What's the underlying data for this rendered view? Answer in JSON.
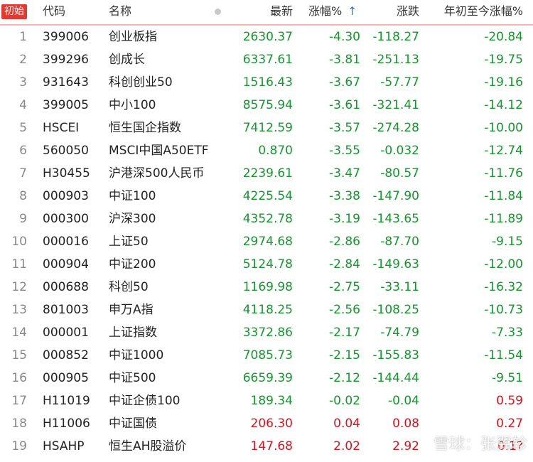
{
  "header": {
    "tag": "初始",
    "code": "代码",
    "name": "名称",
    "last": "最新",
    "pct": "涨幅%",
    "chg": "涨跌",
    "ytd": "年初至今涨幅%",
    "sort_arrow": "↑"
  },
  "rows": [
    {
      "idx": "1",
      "code": "399006",
      "name": "创业板指",
      "last": "2630.37",
      "pct": "-4.30",
      "chg": "-118.27",
      "ytd": "-20.84"
    },
    {
      "idx": "2",
      "code": "399296",
      "name": "创成长",
      "last": "6337.61",
      "pct": "-3.81",
      "chg": "-251.13",
      "ytd": "-19.75"
    },
    {
      "idx": "3",
      "code": "931643",
      "name": "科创创业50",
      "last": "1516.43",
      "pct": "-3.67",
      "chg": "-57.77",
      "ytd": "-19.16"
    },
    {
      "idx": "4",
      "code": "399005",
      "name": "中小100",
      "last": "8575.94",
      "pct": "-3.61",
      "chg": "-321.41",
      "ytd": "-14.12"
    },
    {
      "idx": "5",
      "code": "HSCEI",
      "name": "恒生国企指数",
      "last": "7412.59",
      "pct": "-3.57",
      "chg": "-274.28",
      "ytd": "-10.00"
    },
    {
      "idx": "6",
      "code": "560050",
      "name": "MSCI中国A50ETF",
      "last": "0.870",
      "pct": "-3.55",
      "chg": "-0.032",
      "ytd": "-12.74"
    },
    {
      "idx": "7",
      "code": "H30455",
      "name": "沪港深500人民币",
      "last": "2239.61",
      "pct": "-3.47",
      "chg": "-80.57",
      "ytd": "-11.76"
    },
    {
      "idx": "8",
      "code": "000903",
      "name": "中证100",
      "last": "4225.54",
      "pct": "-3.38",
      "chg": "-147.90",
      "ytd": "-11.84"
    },
    {
      "idx": "9",
      "code": "000300",
      "name": "沪深300",
      "last": "4352.78",
      "pct": "-3.19",
      "chg": "-143.65",
      "ytd": "-11.89"
    },
    {
      "idx": "10",
      "code": "000016",
      "name": "上证50",
      "last": "2974.68",
      "pct": "-2.86",
      "chg": "-87.70",
      "ytd": "-9.15"
    },
    {
      "idx": "11",
      "code": "000904",
      "name": "中证200",
      "last": "5124.78",
      "pct": "-2.84",
      "chg": "-149.63",
      "ytd": "-12.00"
    },
    {
      "idx": "12",
      "code": "000688",
      "name": "科创50",
      "last": "1169.98",
      "pct": "-2.75",
      "chg": "-33.11",
      "ytd": "-16.32"
    },
    {
      "idx": "13",
      "code": "801003",
      "name": "申万A指",
      "last": "4118.25",
      "pct": "-2.56",
      "chg": "-108.25",
      "ytd": "-10.73"
    },
    {
      "idx": "14",
      "code": "000001",
      "name": "上证指数",
      "last": "3372.86",
      "pct": "-2.17",
      "chg": "-74.79",
      "ytd": "-7.33"
    },
    {
      "idx": "15",
      "code": "000852",
      "name": "中证1000",
      "last": "7085.73",
      "pct": "-2.15",
      "chg": "-155.83",
      "ytd": "-11.54"
    },
    {
      "idx": "16",
      "code": "000905",
      "name": "中证500",
      "last": "6659.39",
      "pct": "-2.12",
      "chg": "-144.44",
      "ytd": "-9.51"
    },
    {
      "idx": "17",
      "code": "H11019",
      "name": "中证企债100",
      "last": "189.34",
      "pct": "-0.02",
      "chg": "-0.04",
      "ytd": "0.59"
    },
    {
      "idx": "18",
      "code": "H11006",
      "name": "中证国债",
      "last": "206.30",
      "pct": "0.04",
      "chg": "0.08",
      "ytd": "0.27"
    },
    {
      "idx": "19",
      "code": "HSAHP",
      "name": "恒生AH股溢价",
      "last": "147.68",
      "pct": "2.02",
      "chg": "2.92",
      "ytd": "0.1?"
    }
  ],
  "watermark": "雪球：张翼轸",
  "colors": {
    "up": "#e0101a",
    "down": "#0f9a2a",
    "header_tag": "#e5382f",
    "divider": "#f0b8b0"
  }
}
